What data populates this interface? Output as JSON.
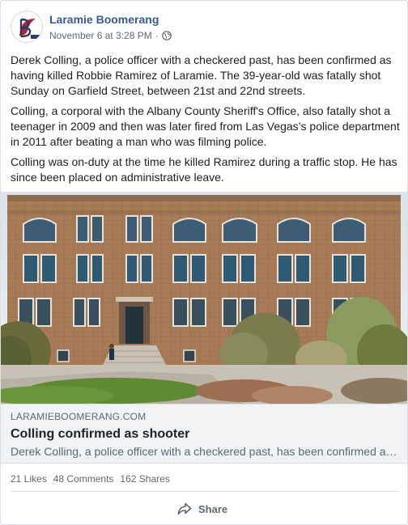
{
  "post": {
    "page_name": "Laramie Boomerang",
    "timestamp": "November 6 at 3:28 PM",
    "separator": "·",
    "privacy_icon": "globe-icon",
    "paragraphs": [
      "Derek Colling, a police officer with a checkered past, has been confirmed as having killed Robbie Ramirez of Laramie. The 39-year-old was fatally shot Sunday on Garfield Street, between 21st and 22nd streets.",
      "Colling, a corporal with the Albany County Sheriff's Office, also fatally shot a teenager in 2009 and then was later fired from Las Vegas’s police department in 2011 after beating a man who was filming police.",
      "Colling was on-duty at the time he killed Ramirez during a traffic stop. He has since been placed on administrative leave."
    ]
  },
  "link_preview": {
    "domain": "LARAMIEBOOMERANG.COM",
    "headline": "Colling confirmed as shooter",
    "description": "Derek Colling, a police officer with a checkered past, has been confirmed as having killed Robbie Ramirez of Laramie."
  },
  "stats": {
    "likes": "21 Likes",
    "comments": "48 Comments",
    "shares": "162 Shares"
  },
  "actions": {
    "share_label": "Share",
    "share_icon": "share-arrow-icon"
  },
  "colors": {
    "page_name": "#385898",
    "secondary_text": "#616770",
    "link_box_bg": "#f2f3f5",
    "brick": "#a87c58"
  }
}
